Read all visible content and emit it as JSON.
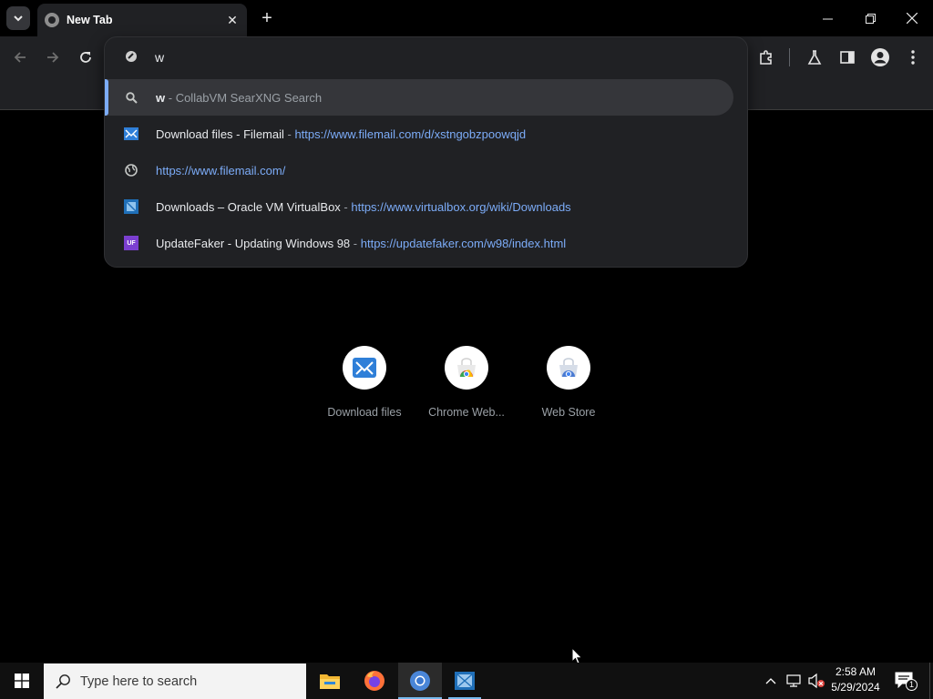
{
  "browser": {
    "tab_title": "New Tab",
    "omnibox_text": "w"
  },
  "suggestions": [
    {
      "icon": "search-icon",
      "main": "w",
      "sep": " - ",
      "rest": "CollabVM SearXNG Search"
    },
    {
      "icon": "filemail-icon",
      "main": "Download files - Filemail",
      "sep": " - ",
      "url": "https://www.filemail.com/d/xstngobzpoowqjd"
    },
    {
      "icon": "globe-icon",
      "url": "https://www.filemail.com/"
    },
    {
      "icon": "virtualbox-icon",
      "main": "Downloads – Oracle VM VirtualBox",
      "sep": " - ",
      "url": "https://www.virtualbox.org/wiki/Downloads"
    },
    {
      "icon": "updatefaker-icon",
      "badge": "UF",
      "main": "UpdateFaker - Updating Windows 98",
      "sep": " - ",
      "url": "https://updatefaker.com/w98/index.html"
    }
  ],
  "shortcuts": [
    {
      "label": "Download files",
      "icon": "filemail-icon"
    },
    {
      "label": "Chrome Web...",
      "icon": "chrome-web-store-icon"
    },
    {
      "label": "Web Store",
      "icon": "web-store-icon"
    }
  ],
  "taskbar": {
    "search_placeholder": "Type here to search",
    "time": "2:58 AM",
    "date": "5/29/2024",
    "notification_count": "1"
  },
  "colors": {
    "accent": "#7cacf8",
    "toolbar": "#202124",
    "selected_row": "#35363a"
  }
}
